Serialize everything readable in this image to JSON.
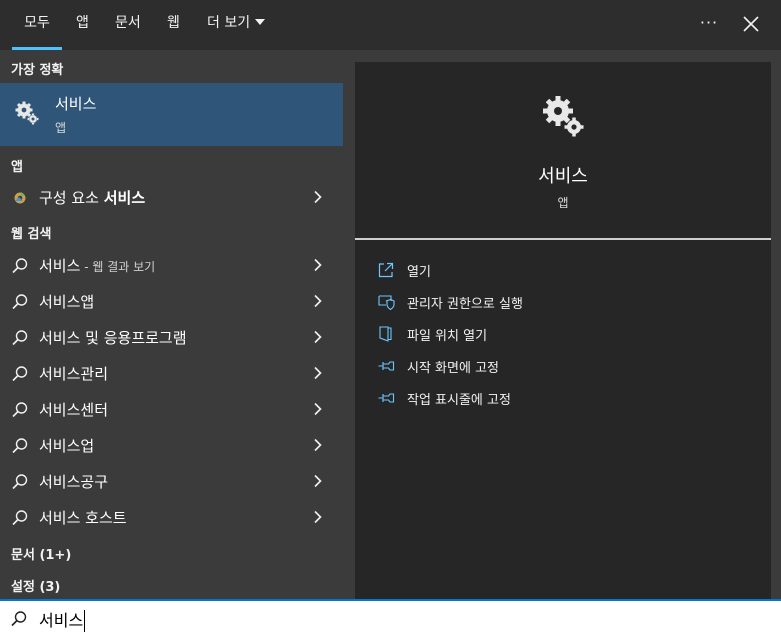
{
  "tabs": [
    {
      "label": "모두",
      "active": true
    },
    {
      "label": "앱"
    },
    {
      "label": "문서"
    },
    {
      "label": "웹"
    },
    {
      "label": "더 보기"
    }
  ],
  "toolbar": {
    "more_icon": "ellipsis-icon",
    "close_icon": "close-icon",
    "ellipsis_text": "···"
  },
  "left": {
    "best_match_header": "가장 정확",
    "best_match": {
      "title": "서비스",
      "subtitle": "앱",
      "icon": "gears-icon"
    },
    "apps_header": "앱",
    "apps": [
      {
        "label_prefix": "구성 요소 ",
        "label_bold": "서비스",
        "icon": "component-services-icon"
      }
    ],
    "web_header": "웹 검색",
    "web_results": [
      {
        "label": "서비스",
        "sub": " - 웹 결과 보기"
      },
      {
        "label": "서비스앱",
        "sub": ""
      },
      {
        "label": "서비스 및 응용프로그램",
        "sub": ""
      },
      {
        "label": "서비스관리",
        "sub": ""
      },
      {
        "label": "서비스센터",
        "sub": ""
      },
      {
        "label": "서비스업",
        "sub": ""
      },
      {
        "label": "서비스공구",
        "sub": ""
      },
      {
        "label": "서비스 호스트",
        "sub": ""
      }
    ],
    "documents_header": "문서 (1+)",
    "settings_header": "설정 (3)"
  },
  "right": {
    "title": "서비스",
    "subtitle": "앱",
    "icon": "gears-icon",
    "actions": [
      {
        "label": "열기",
        "icon": "open-icon"
      },
      {
        "label": "관리자 권한으로 실행",
        "icon": "shield-icon"
      },
      {
        "label": "파일 위치 열기",
        "icon": "folder-icon"
      },
      {
        "label": "시작 화면에 고정",
        "icon": "pin-icon"
      },
      {
        "label": "작업 표시줄에 고정",
        "icon": "pin-icon"
      }
    ]
  },
  "search": {
    "value": "서비스",
    "icon": "search-icon"
  },
  "colors": {
    "accent": "#4cc2ff",
    "selection": "#2f5679",
    "panel": "#262626",
    "background": "#3b3b3b"
  }
}
